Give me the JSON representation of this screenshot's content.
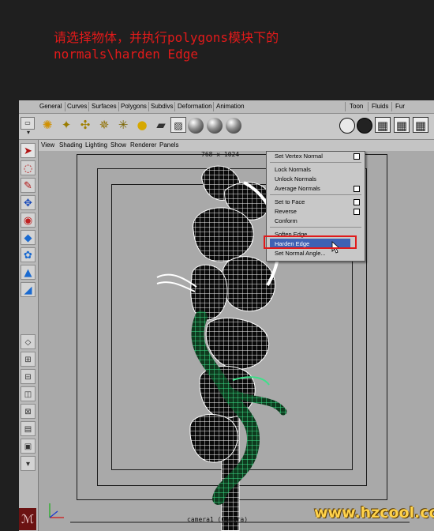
{
  "caption": {
    "line1": "请选择物体，并执行polygons模块下的",
    "line2": "normals\\harden Edge"
  },
  "shelf_tabs": [
    "General",
    "Curves",
    "Surfaces",
    "Polygons",
    "Subdivs",
    "Deformation",
    "Animation",
    "Toon",
    "Fluids",
    "Fur"
  ],
  "view_menu": [
    "View",
    "Shading",
    "Lighting",
    "Show",
    "Renderer",
    "Panels"
  ],
  "viewport": {
    "resolution": "768 x 1024",
    "camera_label": "camera1 (Camera)"
  },
  "normals_menu": {
    "items": [
      {
        "label": "Set Vertex Normal",
        "has_option": true
      },
      {
        "label": "Lock Normals",
        "has_option": false
      },
      {
        "label": "Unlock Normals",
        "has_option": false
      },
      {
        "label": "Average Normals",
        "has_option": true
      },
      {
        "label": "Set to Face",
        "has_option": true
      },
      {
        "label": "Reverse",
        "has_option": true
      },
      {
        "label": "Conform",
        "has_option": false
      },
      {
        "label": "Soften Edge",
        "has_option": false
      },
      {
        "label": "Harden Edge",
        "has_option": false,
        "selected": true
      },
      {
        "label": "Set Normal Angle...",
        "has_option": false
      }
    ]
  },
  "icons": [
    "select-arrow-icon",
    "lasso-icon",
    "paint-icon",
    "move-icon",
    "rotate-icon",
    "scale-icon",
    "sun-light-icon",
    "camera-icon",
    "sphere-icon",
    "clapper-icon"
  ],
  "colors": {
    "caption": "#e21a1a",
    "highlight": "#3f61b4",
    "selected_mesh": "#2fd27a",
    "wireframe": "#ffffff",
    "watermark": "#ffd24a"
  },
  "watermark": "www.hzcool.com"
}
